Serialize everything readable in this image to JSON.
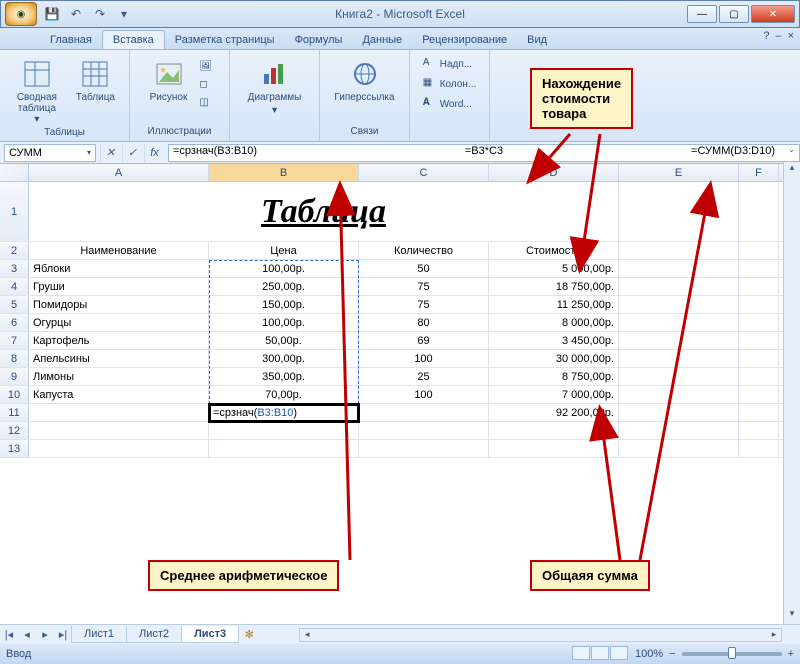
{
  "window": {
    "title": "Книга2 - Microsoft Excel"
  },
  "qat": {
    "save": "💾",
    "undo": "↶",
    "redo": "↷",
    "more": "▾"
  },
  "tabs": {
    "items": [
      "Главная",
      "Вставка",
      "Разметка страницы",
      "Формулы",
      "Данные",
      "Рецензирование",
      "Вид"
    ],
    "active_index": 1,
    "help": "?",
    "mdi_min": "–",
    "mdi_close": "×"
  },
  "ribbon": {
    "group_tables": {
      "label": "Таблицы",
      "pivot": "Сводная\nтаблица ▾",
      "table": "Таблица"
    },
    "group_ill": {
      "label": "Иллюстрации",
      "picture": "Рисунок",
      "more": "▪"
    },
    "group_charts": {
      "label": "",
      "charts": "Диаграммы",
      "drop": "▾"
    },
    "group_links": {
      "label": "Связи",
      "hyper": "Гиперссылка"
    },
    "group_text": {
      "head": "Надп...",
      "col": "Колон...",
      "word": "Word..."
    }
  },
  "formula_bar": {
    "namebox": "СУММ",
    "cancel": "✕",
    "enter": "✓",
    "fx": "fx",
    "text_left": "=срзнач(B3:B10)",
    "text_center": "=B3*C3",
    "text_right": "=СУММ(D3:D10)",
    "expand": "⌄"
  },
  "columns": [
    "A",
    "B",
    "C",
    "D",
    "E",
    "F"
  ],
  "rowheaders": [
    "1",
    "2",
    "3",
    "4",
    "5",
    "6",
    "7",
    "8",
    "9",
    "10",
    "11",
    "12",
    "13"
  ],
  "title_cell": "Таблица",
  "headers": {
    "name": "Наименование",
    "price": "Цена",
    "qty": "Количество",
    "cost": "Стоимость"
  },
  "rows": [
    {
      "name": "Яблоки",
      "price": "100,00р.",
      "qty": "50",
      "cost": "5 000,00р."
    },
    {
      "name": "Груши",
      "price": "250,00р.",
      "qty": "75",
      "cost": "18 750,00р."
    },
    {
      "name": "Помидоры",
      "price": "150,00р.",
      "qty": "75",
      "cost": "11 250,00р."
    },
    {
      "name": "Огурцы",
      "price": "100,00р.",
      "qty": "80",
      "cost": "8 000,00р."
    },
    {
      "name": "Картофель",
      "price": "50,00р.",
      "qty": "69",
      "cost": "3 450,00р."
    },
    {
      "name": "Апельсины",
      "price": "300,00р.",
      "qty": "100",
      "cost": "30 000,00р."
    },
    {
      "name": "Лимоны",
      "price": "350,00р.",
      "qty": "25",
      "cost": "8 750,00р."
    },
    {
      "name": "Капуста",
      "price": "70,00р.",
      "qty": "100",
      "cost": "7 000,00р."
    }
  ],
  "total_cost": "92 200,00р.",
  "b11_formula_plain": "=срзнач(",
  "b11_formula_ref": "B3:B10",
  "b11_formula_close": ")",
  "callouts": {
    "top": "Нахождение\nстоимости\nтовара",
    "left": "Среднее арифметическое",
    "right": "Общаяя сумма"
  },
  "sheets": {
    "nav": [
      "|◂",
      "◂",
      "▸",
      "▸|"
    ],
    "tabs": [
      "Лист1",
      "Лист2",
      "Лист3"
    ],
    "active_index": 2,
    "add": "✻"
  },
  "statusbar": {
    "mode": "Ввод",
    "zoom": "100%",
    "minus": "−",
    "plus": "+"
  },
  "winbtns": {
    "min": "—",
    "max": "▢",
    "close": "✕"
  }
}
